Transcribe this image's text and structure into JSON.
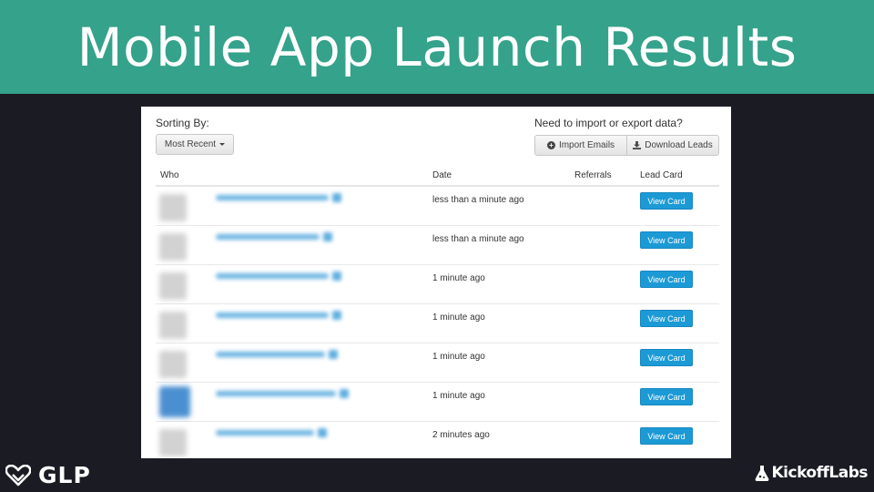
{
  "banner": {
    "title": "Mobile App Launch Results"
  },
  "colors": {
    "banner": "#35a28b",
    "background": "#1b1b24",
    "button": "#1c9ad6"
  },
  "toolbar": {
    "sorting_label": "Sorting By:",
    "sort_value": "Most Recent",
    "export_label": "Need to import or export data?",
    "import_label": "Import Emails",
    "download_label": "Download Leads"
  },
  "table": {
    "columns": {
      "who": "Who",
      "date": "Date",
      "referrals": "Referrals",
      "lead_card": "Lead Card"
    },
    "rows": [
      {
        "date": "less than a minute ago",
        "action": "View Card"
      },
      {
        "date": "less than a minute ago",
        "action": "View Card"
      },
      {
        "date": "1 minute ago",
        "action": "View Card"
      },
      {
        "date": "1 minute ago",
        "action": "View Card"
      },
      {
        "date": "1 minute ago",
        "action": "View Card"
      },
      {
        "date": "1 minute ago",
        "action": "View Card"
      },
      {
        "date": "2 minutes ago",
        "action": "View Card"
      }
    ]
  },
  "footer": {
    "left_logo": "GLP",
    "right_logo": "KickoffLabs"
  }
}
